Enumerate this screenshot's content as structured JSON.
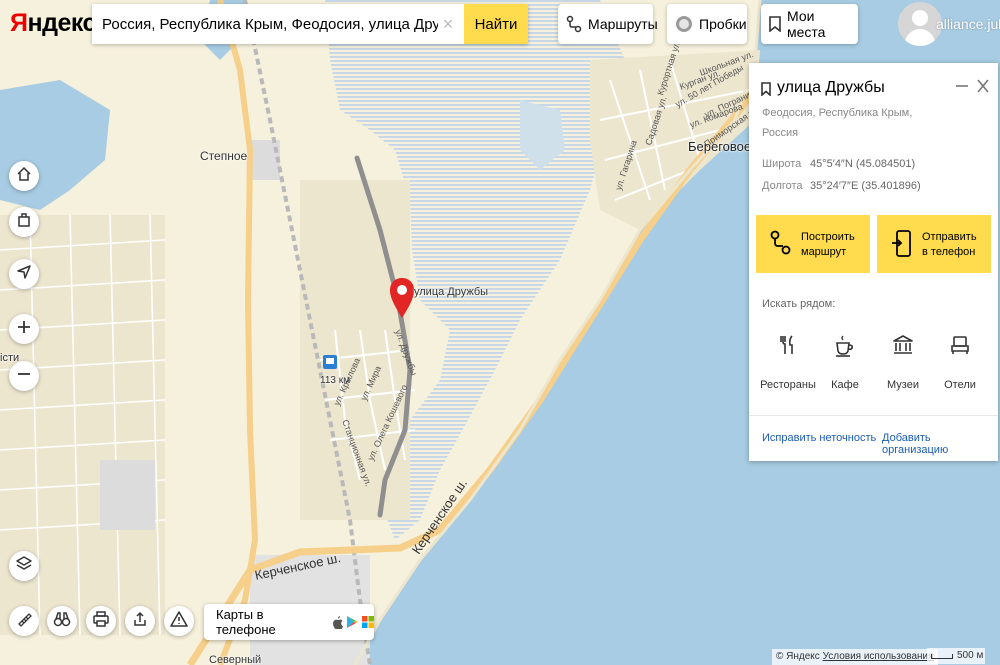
{
  "header": {
    "logo_first": "Я",
    "logo_rest": "ндекс",
    "search_value": "Россия, Республика Крым, Феодосия, улица Дружбы",
    "search_button": "Найти",
    "routes": "Маршруты",
    "traffic": "Пробки",
    "my_places": "Мои места",
    "user_name": "alliance.julia"
  },
  "map": {
    "labels": {
      "stepnoe": "Степное",
      "beregovoe": "Береговое",
      "station_km": "113 км",
      "pin_label": "улица Дружбы",
      "kerch_road_1": "Керченское ш.",
      "kerch_road_2": "Керченское ш.",
      "severny": "Северный",
      "left_edge": "істи",
      "st_druzhby": "ул. Дружбы",
      "st_krylova": "ул. Крылова",
      "st_mira": "ул. Мира",
      "st_koshevogo": "ул. Олега Кошевого",
      "st_stantsionnaya": "Станционная ул.",
      "st_gagarina": "ул. Гагарина",
      "st_sadovaya": "Садовая ул.",
      "st_kurortnaya": "Курортная ул.",
      "st_komarova": "ул. Комарова",
      "st_kurgan": "Курган ул.",
      "st_50let": "ул. 50 лет Победы",
      "st_shkolnaya": "Школьная ул.",
      "st_pogranichnaya": "ул. Пограничная",
      "st_primorskaya": "Приморская ул."
    },
    "colors": {
      "land": "#f6f1dc",
      "water": "#a7cce3",
      "wetland_line": "#bcd1ea",
      "major_road": "#f6cf8a",
      "route": "#8f8f8f",
      "pin": "#e22626"
    }
  },
  "card": {
    "title": "улица Дружбы",
    "address": "Феодосия, Республика Крым, Россия",
    "lat_label": "Широта",
    "lat_value": "45°5′4″N (45.084501)",
    "lon_label": "Долгота",
    "lon_value": "35°24′7″E (35.401896)",
    "route_btn_line1": "Построить",
    "route_btn_line2": "маршрут",
    "send_btn_line1": "Отправить",
    "send_btn_line2": "в телефон",
    "nearby_title": "Искать рядом:",
    "categories": [
      "Рестораны",
      "Кафе",
      "Музеи",
      "Отели"
    ],
    "fix_link": "Исправить неточность",
    "add_org_link": "Добавить организацию"
  },
  "bottom": {
    "phone_promo": "Карты в телефоне"
  },
  "footer": {
    "copyright": "© Яндекс",
    "terms": "Условия использования",
    "scale": "500 м"
  }
}
